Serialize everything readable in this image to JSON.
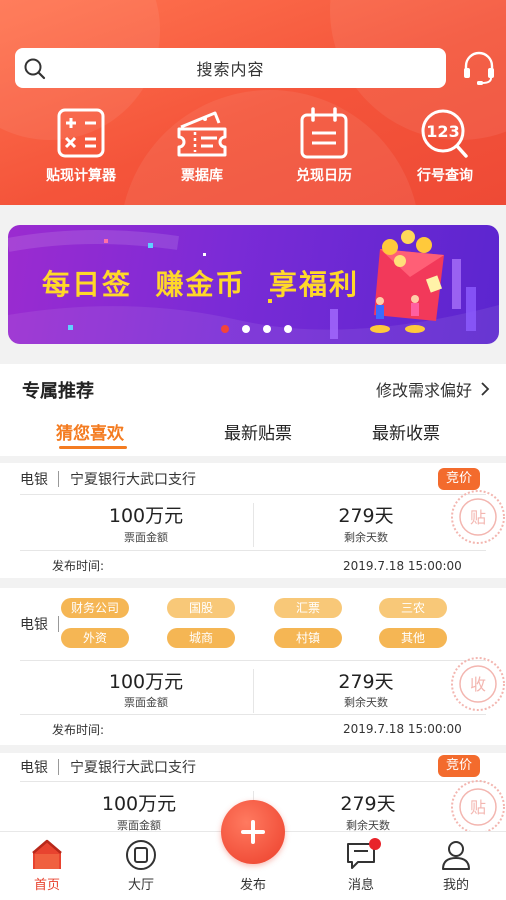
{
  "search": {
    "placeholder": "搜索内容"
  },
  "quick_actions": [
    {
      "label": "贴现计算器",
      "icon": "calculator-icon"
    },
    {
      "label": "票据库",
      "icon": "ticket-icon"
    },
    {
      "label": "兑现日历",
      "icon": "calendar-icon"
    },
    {
      "label": "行号查询",
      "icon": "search-number-icon",
      "icon_text": "123"
    }
  ],
  "banner": {
    "slogan": "每日签  赚金币  享福利",
    "dots": 4,
    "active_dot": 1
  },
  "recommend": {
    "title": "专属推荐",
    "edit_label": "修改需求偏好",
    "tabs": [
      "猜您喜欢",
      "最新贴票",
      "最新收票"
    ],
    "active_tab": 0
  },
  "cards": [
    {
      "type": "电银",
      "bank": "宁夏银行大武口支行",
      "badge": "竞价",
      "amount": "100万元",
      "amount_label": "票面金额",
      "days": "279天",
      "days_label": "剩余天数",
      "pub_label": "发布时间:",
      "pub_time": "2019.7.18  15:00:00",
      "stamp": "贴"
    },
    {
      "type": "电银",
      "tags": [
        "财务公司",
        "国股",
        "汇票",
        "三农",
        "外资",
        "城商",
        "村镇",
        "其他"
      ],
      "amount": "100万元",
      "amount_label": "票面金额",
      "days": "279天",
      "days_label": "剩余天数",
      "pub_label": "发布时间:",
      "pub_time": "2019.7.18  15:00:00",
      "stamp": "收"
    },
    {
      "type": "电银",
      "bank": "宁夏银行大武口支行",
      "badge": "竞价",
      "amount": "100万元",
      "amount_label": "票面金额",
      "days": "279天",
      "days_label": "剩余天数",
      "stamp": "贴"
    }
  ],
  "nav": {
    "items": [
      {
        "label": "首页",
        "icon": "home-icon"
      },
      {
        "label": "大厅",
        "icon": "hall-icon"
      },
      {
        "label": "发布",
        "icon": "plus-icon"
      },
      {
        "label": "消息",
        "icon": "message-icon"
      },
      {
        "label": "我的",
        "icon": "user-icon"
      }
    ],
    "active": 0
  },
  "colors": {
    "header": "#f4543a",
    "accent_orange": "#f47c21",
    "badge": "#f36b2d",
    "tag": "#f5b654",
    "banner_text": "#ffd829",
    "nav_active": "#e8432f"
  }
}
